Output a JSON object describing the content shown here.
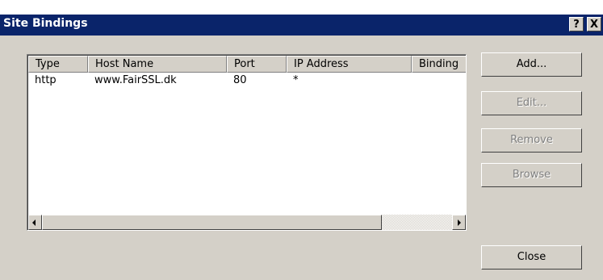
{
  "window": {
    "title": "Site Bindings",
    "help_label": "?",
    "close_label": "X"
  },
  "bindings": {
    "columns": [
      "Type",
      "Host Name",
      "Port",
      "IP Address",
      "Binding"
    ],
    "rows": [
      {
        "type": "http",
        "host_name": "www.FairSSL.dk",
        "port": "80",
        "ip_address": "*",
        "binding": ""
      }
    ]
  },
  "buttons": {
    "add": "Add...",
    "edit": "Edit...",
    "remove": "Remove",
    "browse": "Browse",
    "close": "Close"
  },
  "button_states": {
    "add": "enabled",
    "edit": "disabled",
    "remove": "disabled",
    "browse": "disabled",
    "close": "enabled"
  },
  "colors": {
    "titlebar": "#0a246a",
    "face": "#d4d0c8"
  }
}
